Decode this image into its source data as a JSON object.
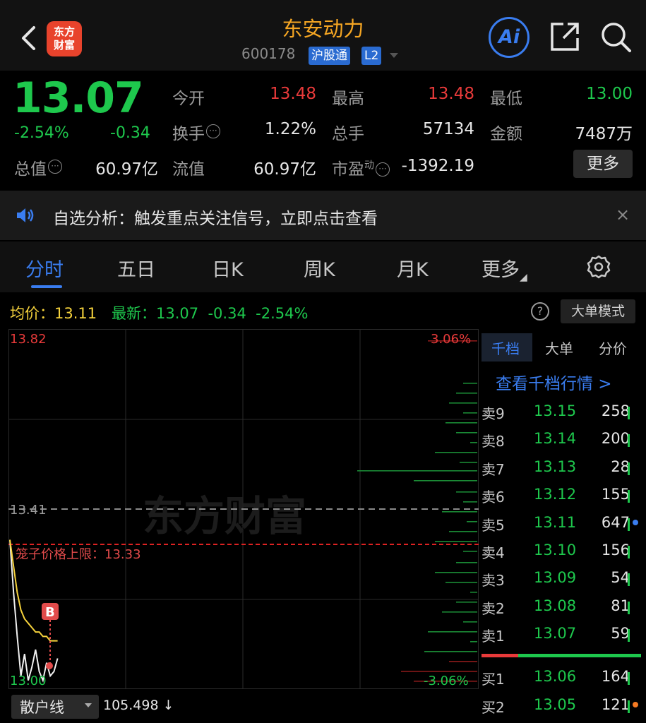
{
  "header": {
    "logo_text": "东方财富",
    "title": "东安动力",
    "code": "600178",
    "tag_hgt": "沪股通",
    "tag_l2": "L2",
    "ai_label": "Ai"
  },
  "quote": {
    "price": "13.07",
    "pct": "-2.54%",
    "change": "-0.34",
    "open_label": "今开",
    "open": "13.48",
    "high_label": "最高",
    "high": "13.48",
    "low_label": "最低",
    "low": "13.00",
    "turnover_label": "换手",
    "turnover": "1.22%",
    "volume_label": "总手",
    "volume": "57134",
    "amount_label": "金额",
    "amount": "7487万",
    "mktcap_label": "总值",
    "mktcap": "60.97亿",
    "float_label": "流值",
    "float_cap": "60.97亿",
    "pe_label": "市盈",
    "pe_sup": "动",
    "pe": "-1392.19",
    "more_label": "更多"
  },
  "banner": {
    "text": "自选分析：触发重点关注信号，立即点击查看",
    "close": "×"
  },
  "tabs": [
    {
      "label": "分时"
    },
    {
      "label": "五日"
    },
    {
      "label": "日K"
    },
    {
      "label": "周K"
    },
    {
      "label": "月K"
    },
    {
      "label": "更多"
    }
  ],
  "info_line": {
    "avg": "均价：13.11",
    "latest": "最新：13.07  -0.34  -2.54%",
    "help": "?",
    "mode": "大单模式"
  },
  "chart": {
    "top_price": "13.82",
    "mid_price": "13.41",
    "bottom_price": "13.00",
    "top_pct": "3.06%",
    "bottom_pct": "-3.06%",
    "limit_label": "笼子价格上限：13.33",
    "b_marker": "B",
    "watermark": "东方财富"
  },
  "chart_data": {
    "type": "line",
    "title": "",
    "ylim": [
      13.0,
      13.82
    ],
    "reference_price": 13.41,
    "cage_upper_limit": 13.33,
    "series": [
      {
        "values": [
          13.34,
          13.22,
          13.12,
          13.03,
          13.08,
          13.02,
          13.05,
          13.09,
          13.04,
          13.02,
          13.06,
          13.03,
          13.04,
          13.07
        ]
      },
      {
        "values": [
          13.34,
          13.28,
          13.22,
          13.18,
          13.16,
          13.15,
          13.14,
          13.13,
          13.13,
          13.12,
          13.12,
          13.11,
          13.11,
          13.11
        ]
      }
    ],
    "grid": true
  },
  "orderbook": {
    "tabs": [
      "千档",
      "大单",
      "分价"
    ],
    "link": "查看千档行情 >",
    "asks": [
      {
        "label": "卖9",
        "price": "13.15",
        "vol": "258"
      },
      {
        "label": "卖8",
        "price": "13.14",
        "vol": "200"
      },
      {
        "label": "卖7",
        "price": "13.13",
        "vol": "28"
      },
      {
        "label": "卖6",
        "price": "13.12",
        "vol": "155"
      },
      {
        "label": "卖5",
        "price": "13.11",
        "vol": "647"
      },
      {
        "label": "卖4",
        "price": "13.10",
        "vol": "156"
      },
      {
        "label": "卖3",
        "price": "13.09",
        "vol": "54"
      },
      {
        "label": "卖2",
        "price": "13.08",
        "vol": "81"
      },
      {
        "label": "卖1",
        "price": "13.07",
        "vol": "59"
      }
    ],
    "bids": [
      {
        "label": "买1",
        "price": "13.06",
        "vol": "164"
      },
      {
        "label": "买2",
        "price": "13.05",
        "vol": "121"
      }
    ]
  },
  "bottom": {
    "select": "散户线",
    "value": "105.498 ↓"
  },
  "colors": {
    "up": "#e83a3a",
    "down": "#1ec84d",
    "accent": "#3a7df0",
    "title": "#f5a623",
    "avg_line": "#f5d23c"
  }
}
